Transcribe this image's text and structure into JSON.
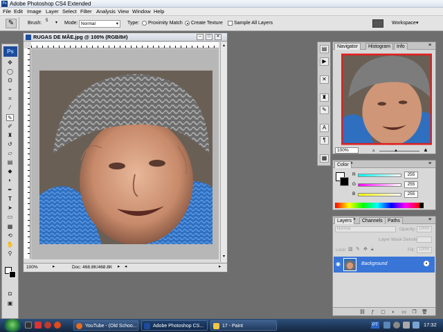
{
  "app": {
    "title": "Adobe Photoshop CS4 Extended",
    "icon": "Ps"
  },
  "menu": [
    "File",
    "Edit",
    "Image",
    "Layer",
    "Select",
    "Filter",
    "Analysis",
    "View",
    "Window",
    "Help"
  ],
  "options": {
    "brush_label": "Brush:",
    "brush_size": "5",
    "mode_label": "Mode:",
    "mode_value": "Normal",
    "type_label": "Type:",
    "type_proximity": "Proximity Match",
    "type_create": "Create Texture",
    "type_selected": "Create Texture",
    "sample_all": "Sample All Layers",
    "workspace": "Workspace"
  },
  "document": {
    "title": "RUGAS DE MÃE.jpg @ 100% (RGB/8#)",
    "zoom": "100%",
    "doc_info": "Doc: 468.8K/468.8K"
  },
  "navigator": {
    "tabs": [
      "Navigator",
      "Histogram",
      "Info"
    ],
    "zoom": "100%"
  },
  "color": {
    "tab": "Color",
    "channels": [
      {
        "label": "R",
        "value": "255"
      },
      {
        "label": "G",
        "value": "255"
      },
      {
        "label": "B",
        "value": "255"
      }
    ]
  },
  "layers": {
    "tabs": [
      "Layers",
      "Channels",
      "Paths"
    ],
    "blend_mode": "Normal",
    "opacity_label": "Opacity:",
    "opacity": "100%",
    "layer_mask_density": "Layer Mask Density",
    "lock_label": "Lock:",
    "fill_label": "Fill:",
    "fill": "100%",
    "rows": [
      {
        "name": "Background"
      }
    ]
  },
  "taskbar": {
    "items": [
      "YouTube - (Old Schoo...",
      "Adobe Photoshop CS...",
      "17 - Paint"
    ],
    "lang": "PT",
    "clock": "17:32"
  },
  "colors": {
    "accent": "#3875d7",
    "taskbar": "#1d3556"
  }
}
